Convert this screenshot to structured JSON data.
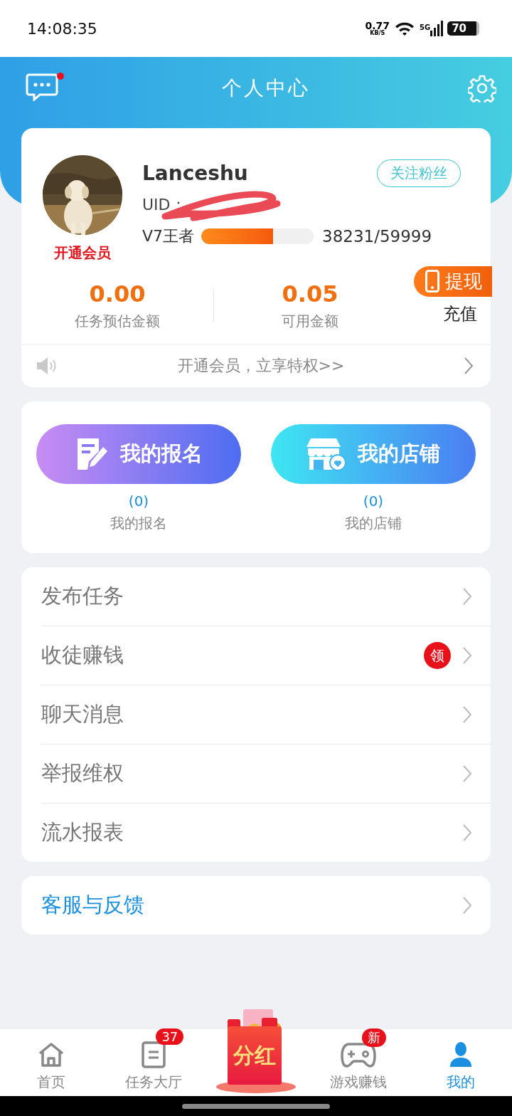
{
  "status_bar": {
    "time": "14:08:35",
    "speed": "0.77",
    "speed_unit": "KB/S",
    "network": "5G",
    "battery": "70"
  },
  "header": {
    "title": "个人中心",
    "message_dot": true
  },
  "profile": {
    "name": "Lanceshu",
    "uid_label": "UID：",
    "follow_button": "关注粉丝",
    "membership_link": "开通会员",
    "level_name": "V7王者",
    "level": 0.637,
    "points": "38231/59999"
  },
  "balances": [
    {
      "amount": "0.00",
      "label": "任务预估金额"
    },
    {
      "amount": "0.05",
      "label": "可用金额"
    }
  ],
  "withdraw_button": "提现",
  "recharge_link": "充值",
  "notice": "开通会员，立享特权>>",
  "shortcuts": [
    {
      "kind": "signup",
      "label": "我的报名",
      "count": "(0)",
      "caption": "我的报名"
    },
    {
      "kind": "shop",
      "label": "我的店铺",
      "count": "(0)",
      "caption": "我的店铺"
    }
  ],
  "menu": [
    {
      "label": "发布任务"
    },
    {
      "label": "收徒赚钱",
      "badge": "领"
    },
    {
      "label": "聊天消息"
    },
    {
      "label": "举报维权"
    },
    {
      "label": "流水报表"
    }
  ],
  "support": {
    "label": "客服与反馈"
  },
  "tab_bar": [
    {
      "kind": "home",
      "label": "首页",
      "selected": false
    },
    {
      "kind": "tasks",
      "label": "任务大厅",
      "badge": "37",
      "selected": false
    },
    {
      "kind": "bonus",
      "label": "分红"
    },
    {
      "kind": "game",
      "label": "游戏赚钱",
      "badge": "新",
      "selected": false
    },
    {
      "kind": "me",
      "label": "我的",
      "selected": true
    }
  ]
}
